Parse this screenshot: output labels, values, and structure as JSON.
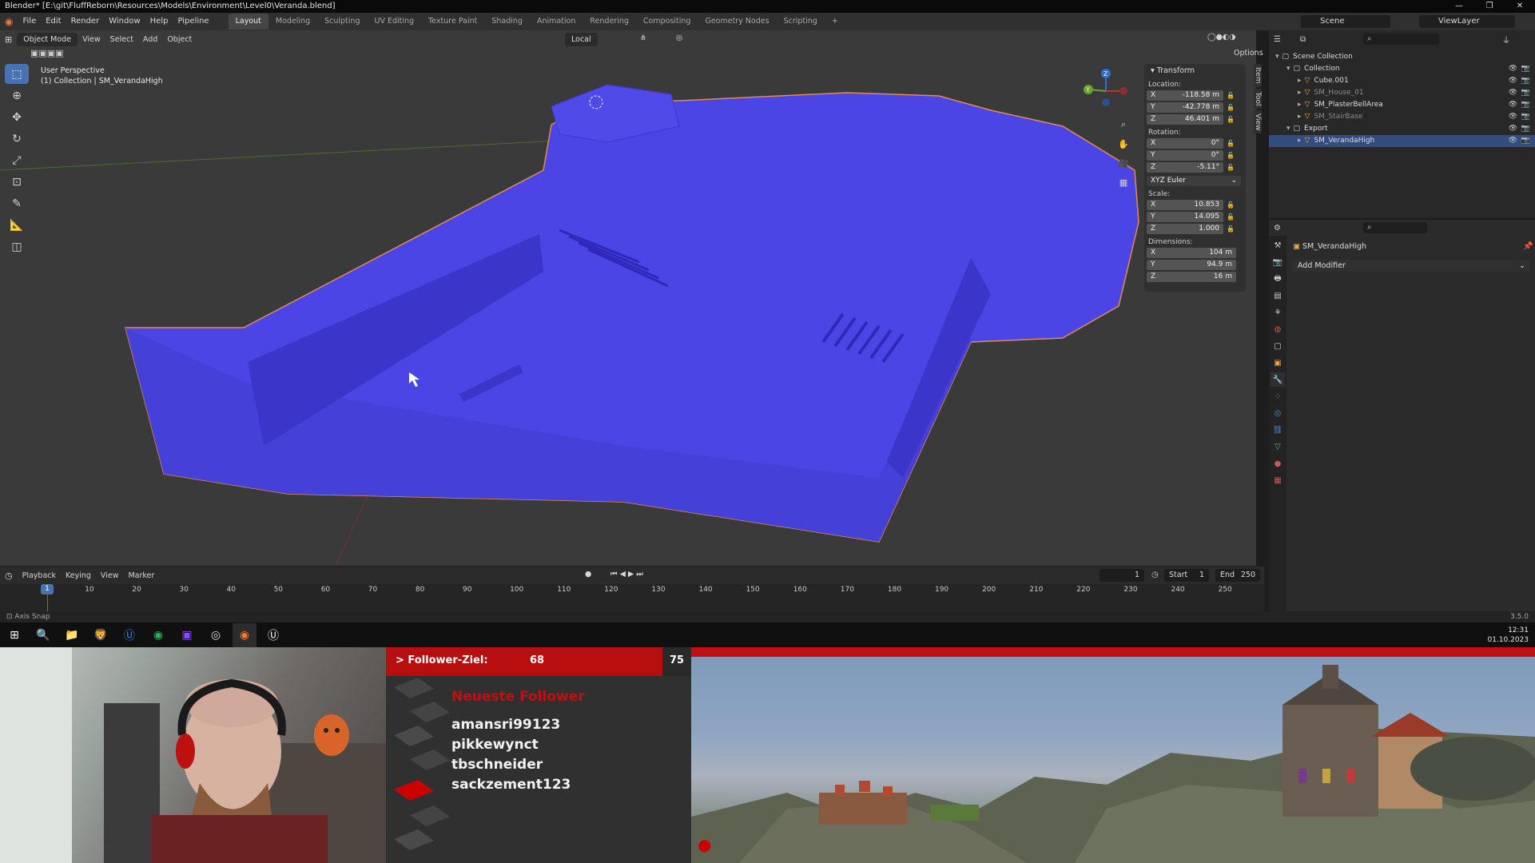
{
  "window": {
    "title": "Blender* [E:\\git\\FluffReborn\\Resources\\Models\\Environment\\Level0\\Veranda.blend]",
    "controls": [
      "—",
      "❐",
      "✕"
    ]
  },
  "menubar": {
    "items": [
      "File",
      "Edit",
      "Render",
      "Window",
      "Help",
      "Pipeline"
    ],
    "workspaces": [
      "Layout",
      "Modeling",
      "Sculpting",
      "UV Editing",
      "Texture Paint",
      "Shading",
      "Animation",
      "Rendering",
      "Compositing",
      "Geometry Nodes",
      "Scripting"
    ],
    "active_workspace": "Layout",
    "add_tab": "+",
    "scene": "Scene",
    "view_layer": "ViewLayer"
  },
  "viewport_header": {
    "mode": "Object Mode",
    "menus": [
      "View",
      "Select",
      "Add",
      "Object"
    ],
    "transform_orientation": "Local",
    "options": "Options"
  },
  "viewport": {
    "perspective": "User Perspective",
    "collection_info": "(1) Collection | SM_VerandaHigh",
    "gizmo_axes": [
      "X",
      "Y",
      "Z"
    ]
  },
  "transform_panel": {
    "title": "Transform",
    "location_label": "Location:",
    "location": [
      {
        "axis": "X",
        "value": "-118.58 m"
      },
      {
        "axis": "Y",
        "value": "-42.778 m"
      },
      {
        "axis": "Z",
        "value": "46.401 m"
      }
    ],
    "rotation_label": "Rotation:",
    "rotation": [
      {
        "axis": "X",
        "value": "0°"
      },
      {
        "axis": "Y",
        "value": "0°"
      },
      {
        "axis": "Z",
        "value": "-5.11°"
      }
    ],
    "rotation_mode": "XYZ Euler",
    "scale_label": "Scale:",
    "scale": [
      {
        "axis": "X",
        "value": "10.853"
      },
      {
        "axis": "Y",
        "value": "14.095"
      },
      {
        "axis": "Z",
        "value": "1.000"
      }
    ],
    "dimensions_label": "Dimensions:",
    "dimensions": [
      {
        "axis": "X",
        "value": "104 m"
      },
      {
        "axis": "Y",
        "value": "94.9 m"
      },
      {
        "axis": "Z",
        "value": "16 m"
      }
    ],
    "side_tabs": [
      "Item",
      "Tool",
      "View"
    ]
  },
  "timeline": {
    "menus": [
      "Playback",
      "Keying",
      "View",
      "Marker"
    ],
    "current_frame": "1",
    "start_label": "Start",
    "start": "1",
    "end_label": "End",
    "end": "250",
    "ticks": [
      "1",
      "10",
      "20",
      "30",
      "40",
      "50",
      "60",
      "70",
      "80",
      "90",
      "100",
      "110",
      "120",
      "130",
      "140",
      "150",
      "160",
      "170",
      "180",
      "190",
      "200",
      "210",
      "220",
      "230",
      "240",
      "250"
    ]
  },
  "outliner": {
    "rows": [
      {
        "label": "Scene Collection",
        "indent": 0,
        "dim": false,
        "selected": false
      },
      {
        "label": "Collection",
        "indent": 1,
        "dim": false,
        "selected": false
      },
      {
        "label": "Cube.001",
        "indent": 2,
        "dim": false,
        "selected": false
      },
      {
        "label": "SM_House_01",
        "indent": 2,
        "dim": true,
        "selected": false
      },
      {
        "label": "SM_PlasterBellArea",
        "indent": 2,
        "dim": false,
        "selected": false
      },
      {
        "label": "SM_StairBase",
        "indent": 2,
        "dim": true,
        "selected": false
      },
      {
        "label": "Export",
        "indent": 1,
        "dim": false,
        "selected": false
      },
      {
        "label": "SM_VerandaHigh",
        "indent": 2,
        "dim": false,
        "selected": true
      }
    ]
  },
  "properties": {
    "object_name": "SM_VerandaHigh",
    "add_modifier": "Add Modifier"
  },
  "statusbar": {
    "hint": "Axis Snap",
    "version": "3.5.0"
  },
  "taskbar": {
    "time": "12:31",
    "date": "01.10.2023"
  },
  "stream": {
    "goal_label": "> Follower-Ziel:",
    "goal_current": "68",
    "goal_target": "75",
    "goal_progress": 0.9067,
    "latest_title": "Neueste Follower",
    "followers": [
      "amansri99123",
      "pikkewynct",
      "tbschneider",
      "sackzement123"
    ]
  },
  "colors": {
    "accent": "#4772b3",
    "mesh": "#4b45e6",
    "goal_red": "#b70f0f"
  }
}
